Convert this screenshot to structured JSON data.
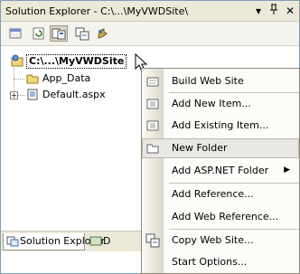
{
  "window": {
    "title": "Solution Explorer - C:\\...\\MyVWDSite\\",
    "pin_glyph": "▾ ₽",
    "close_glyph": "✕"
  },
  "toolbar": {
    "buttons": [
      "properties-icon",
      "refresh-icon",
      "show-all-files-icon",
      "copy-web-site-icon",
      "asp-net-configuration-icon"
    ]
  },
  "tree": {
    "root_label": "C:\\...\\MyVWDSite",
    "items": [
      {
        "label": "App_Data"
      },
      {
        "label": "Default.aspx"
      }
    ]
  },
  "bottom_tabs": {
    "solution_explorer": "Solution Explorer",
    "second_tab": "D"
  },
  "context_menu": {
    "items": [
      {
        "label": "Build Web Site",
        "icon": "build-icon"
      },
      {
        "label": "Add New Item...",
        "icon": "add-new-item-icon"
      },
      {
        "label": "Add Existing Item...",
        "icon": "add-existing-item-icon"
      },
      {
        "label": "New Folder",
        "icon": "new-folder-icon",
        "highlighted": true
      },
      {
        "label": "Add ASP.NET Folder",
        "submenu": true
      },
      {
        "label": "Add Reference..."
      },
      {
        "label": "Add Web Reference..."
      },
      {
        "label": "Copy Web Site...",
        "icon": "copy-web-site-icon"
      },
      {
        "label": "Start Options..."
      }
    ]
  },
  "colors": {
    "panel_border": "#7f9db9",
    "title_bg": "#ece9d8",
    "menu_highlight": "#e8e7e2"
  }
}
